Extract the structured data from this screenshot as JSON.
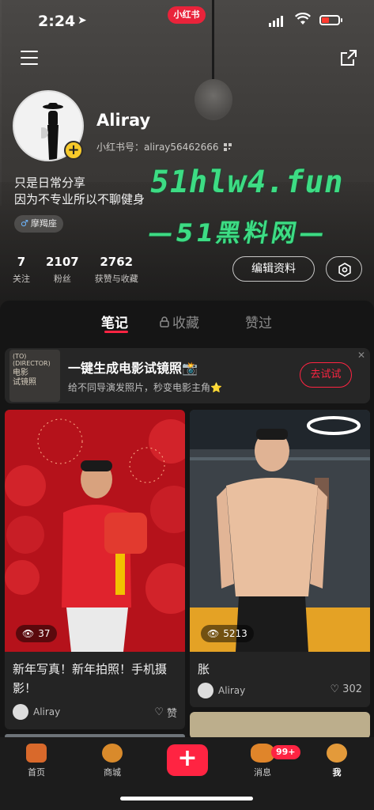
{
  "status": {
    "time": "2:24",
    "app_pill": "小红书"
  },
  "profile": {
    "name": "Aliray",
    "id_label": "小红书号：aliray56462666",
    "bio_line1": "只是日常分享",
    "bio_line2": "因为不专业所以不聊健身",
    "tag": "摩羯座",
    "stats": [
      {
        "value": "7",
        "label": "关注"
      },
      {
        "value": "2107",
        "label": "粉丝"
      },
      {
        "value": "2762",
        "label": "获赞与收藏"
      }
    ],
    "edit_label": "编辑资料"
  },
  "watermark": {
    "line1": "51hlw4.fun",
    "line2": "—51黑料网—"
  },
  "tabs": [
    {
      "label": "笔记"
    },
    {
      "label": "收藏"
    },
    {
      "label": "赞过"
    }
  ],
  "promo": {
    "title": "一键生成电影试镜照📸",
    "subtitle": "给不同导演发照片，秒变电影主角⭐",
    "button": "去试试",
    "thumb_lines": [
      "(TO)",
      "(DIRECTOR)",
      "电影",
      "试镜照"
    ]
  },
  "cards": [
    {
      "views": "37",
      "title_line1": "新年写真！新年拍照！手机摄",
      "title_line2": "影！",
      "author": "Aliray",
      "likes": "赞"
    },
    {
      "views": "5213",
      "title_line1": "胀",
      "title_line2": "",
      "author": "Aliray",
      "likes": "302"
    }
  ],
  "nav": [
    {
      "label": "首页"
    },
    {
      "label": "商城"
    },
    {
      "label": "消息",
      "badge": "99+"
    },
    {
      "label": "我"
    }
  ],
  "colors": {
    "accent": "#ff2442",
    "watermark": "#3ddc84",
    "panel": "#151515"
  }
}
